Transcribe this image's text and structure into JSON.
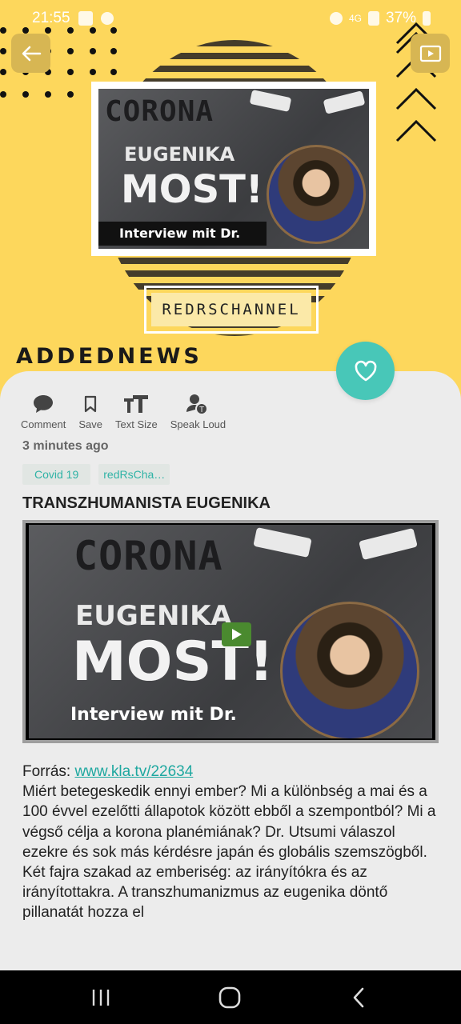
{
  "status_bar": {
    "time": "21:55",
    "battery": "37%",
    "network": "4G"
  },
  "header": {
    "back_icon": "arrow-left-icon",
    "play_icon": "video-play-icon",
    "thumbnail": {
      "line1": "CORONA",
      "line2": "EUGENIKA",
      "line3": "MOST!",
      "line4": "Interview mit Dr. Utsumi"
    },
    "channel": "REDRSCHANNEL",
    "section_title": "ADDEDNEWS"
  },
  "actions": [
    {
      "label": "Comment",
      "icon": "comment-icon"
    },
    {
      "label": "Save",
      "icon": "bookmark-icon"
    },
    {
      "label": "Text Size",
      "icon": "text-size-icon"
    },
    {
      "label": "Speak Loud",
      "icon": "speak-icon"
    }
  ],
  "favorite_icon": "heart-icon",
  "article": {
    "time_ago": "3 minutes ago",
    "tags": [
      "Covid 19",
      "redRsCha…"
    ],
    "title": "TRANSZHUMANISTA EUGENIKA",
    "video_thumbnail": {
      "line1": "CORONA",
      "line2": "EUGENIKA",
      "line3": "MOST!",
      "line4": "Interview mit Dr. Utsumi"
    },
    "source_label": "Forrás: ",
    "source_link": "www.kla.tv/22634",
    "body": "Miért betegeskedik ennyi ember? Mi a különbség a mai és a 100 évvel ezelőtti állapotok között ebből a szempontból? Mi a végső célja a korona planémiának? Dr. Utsumi válaszol ezekre és sok más kérdésre japán és globális szemszögből.",
    "body2": "Két fajra szakad az emberiség: az irányítókra és az irányítottakra. A transzhumanizmus az eugenika döntő pillanatát hozza el"
  },
  "colors": {
    "header_bg": "#fdd75c",
    "card_bg": "#ececec",
    "accent": "#48c7b8",
    "link": "#1fa8a0"
  },
  "nav": [
    "recent-apps-icon",
    "home-icon",
    "back-icon"
  ]
}
